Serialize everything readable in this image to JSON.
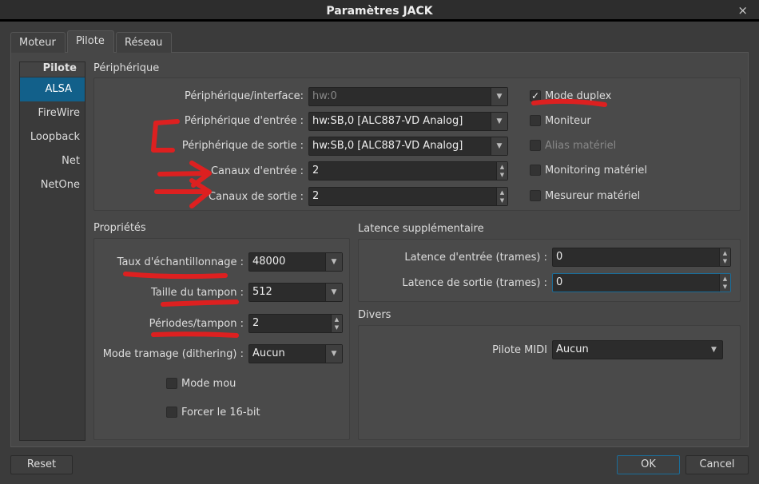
{
  "window": {
    "title": "Paramètres JACK",
    "close_icon": "×"
  },
  "tabs": [
    "Moteur",
    "Pilote",
    "Réseau"
  ],
  "sidebar": {
    "header": "Pilote",
    "items": [
      "ALSA",
      "FireWire",
      "Loopback",
      "Net",
      "NetOne"
    ],
    "selected": "ALSA"
  },
  "peripherique": {
    "title": "Périphérique",
    "interface_label": "Périphérique/interface:",
    "interface_value": "hw:0",
    "input_label": "Périphérique d'entrée :",
    "input_value": "hw:SB,0 [ALC887-VD Analog]",
    "output_label": "Périphérique de sortie :",
    "output_value": "hw:SB,0 [ALC887-VD Analog]",
    "in_channels_label": "Canaux d'entrée :",
    "in_channels_value": "2",
    "out_channels_label": "Canaux de sortie :",
    "out_channels_value": "2",
    "checkboxes": [
      {
        "label": "Mode duplex",
        "checked": true,
        "enabled": true
      },
      {
        "label": "Moniteur",
        "checked": false,
        "enabled": true
      },
      {
        "label": "Alias matériel",
        "checked": false,
        "enabled": false
      },
      {
        "label": "Monitoring matériel",
        "checked": false,
        "enabled": true
      },
      {
        "label": "Mesureur matériel",
        "checked": false,
        "enabled": true
      }
    ]
  },
  "proprietes": {
    "title": "Propriétés",
    "rate_label": "Taux d'échantillonnage :",
    "rate_value": "48000",
    "buffer_label": "Taille du tampon :",
    "buffer_value": "512",
    "periods_label": "Périodes/tampon :",
    "periods_value": "2",
    "dither_label": "Mode tramage (dithering) :",
    "dither_value": "Aucun",
    "soft_mode_label": "Mode mou",
    "force16_label": "Forcer le 16-bit"
  },
  "latence": {
    "title": "Latence supplémentaire",
    "in_label": "Latence d'entrée (trames) :",
    "in_value": "0",
    "out_label": "Latence de sortie (trames) :",
    "out_value": "0"
  },
  "divers": {
    "title": "Divers",
    "midi_label": "Pilote MIDI",
    "midi_value": "Aucun"
  },
  "buttons": {
    "reset": "Reset",
    "ok": "OK",
    "cancel": "Cancel"
  },
  "annotation_color": "#dd2020"
}
